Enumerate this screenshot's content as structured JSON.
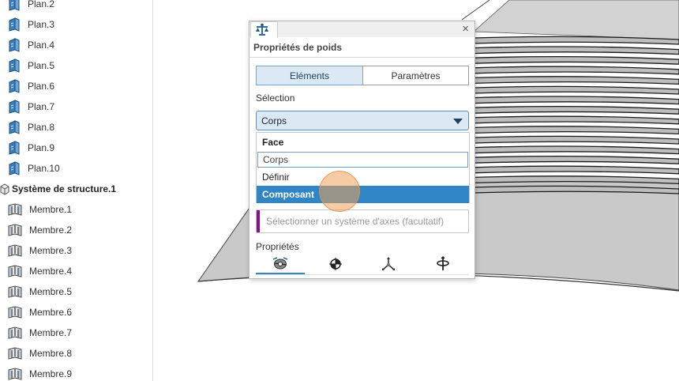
{
  "tree": {
    "plans": [
      "Plan.2",
      "Plan.3",
      "Plan.4",
      "Plan.5",
      "Plan.6",
      "Plan.7",
      "Plan.8",
      "Plan.9",
      "Plan.10"
    ],
    "structure_label": "Système de structure.1",
    "members": [
      "Membre.1",
      "Membre.2",
      "Membre.3",
      "Membre.4",
      "Membre.5",
      "Membre.6",
      "Membre.7",
      "Membre.8",
      "Membre.9"
    ]
  },
  "dialog": {
    "icon": "balance-scale-icon",
    "close": "×",
    "title": "Propriétés de poids",
    "tabs": {
      "elements": "Eléments",
      "parametres": "Paramètres"
    },
    "selection_label": "Sélection",
    "combo_value": "Corps",
    "options": {
      "face": "Face",
      "corps": "Corps",
      "definir": "Définir",
      "composant": "Composant"
    },
    "axes_placeholder": "Sélectionner un système d'axes (facultatif)",
    "properties_label": "Propriétés",
    "property_icons": [
      "mass-properties-icon",
      "center-of-gravity-icon",
      "axes-icon",
      "inertia-icon"
    ]
  },
  "colors": {
    "accent": "#2f85c6",
    "selected_tab": "#dbe9f5",
    "axes_marker": "#8b0f87",
    "icon_blue": "#2b6fa4"
  }
}
